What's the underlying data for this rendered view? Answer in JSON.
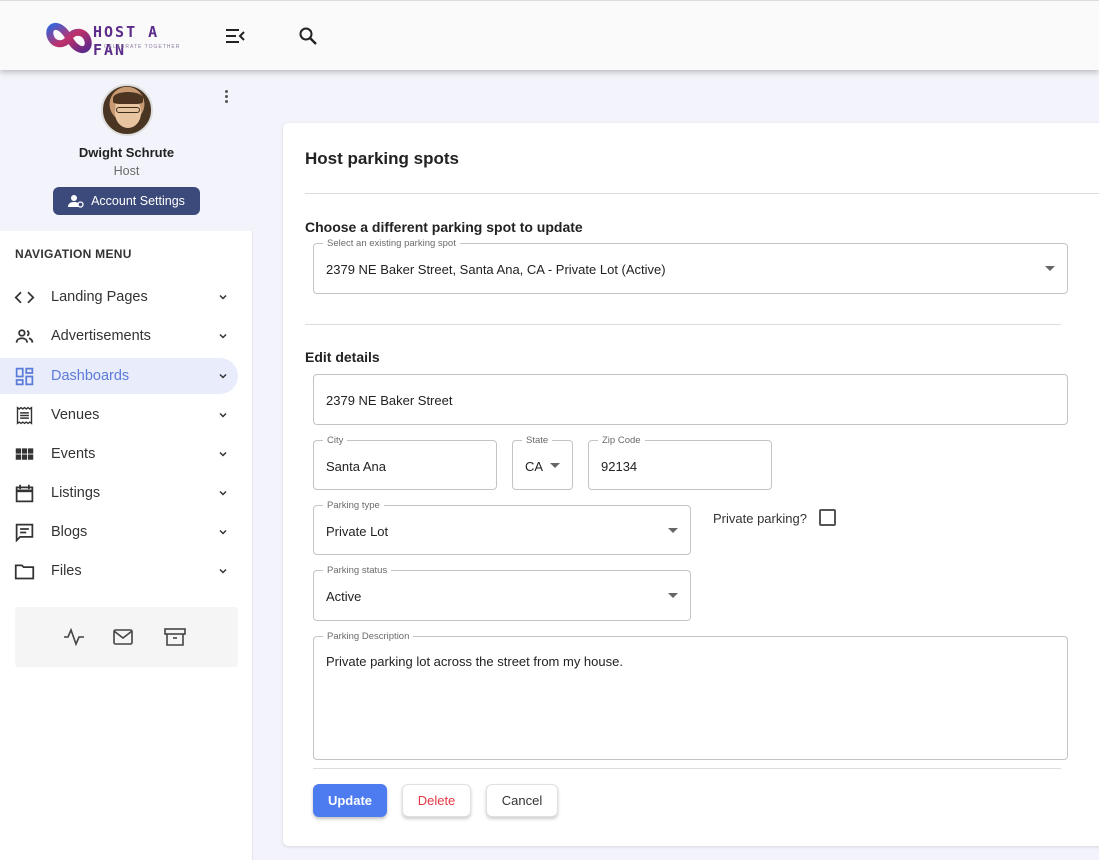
{
  "brand": {
    "name": "HOST A FAN",
    "tagline": "CELEBRATE TOGETHER"
  },
  "topbar": {
    "menu_icon": "menu-collapse-icon",
    "search_icon": "search-icon"
  },
  "profile": {
    "name": "Dwight  Schrute",
    "role": "Host",
    "account_button": "Account Settings",
    "account_icon": "user-cog-icon"
  },
  "nav": {
    "heading": "NAVIGATION MENU",
    "items": [
      {
        "label": "Landing Pages",
        "icon": "code-icon"
      },
      {
        "label": "Advertisements",
        "icon": "people-icon"
      },
      {
        "label": "Dashboards",
        "icon": "dashboard-icon",
        "active": true
      },
      {
        "label": "Venues",
        "icon": "receipt-icon"
      },
      {
        "label": "Events",
        "icon": "grid-icon"
      },
      {
        "label": "Listings",
        "icon": "calendar-icon"
      },
      {
        "label": "Blogs",
        "icon": "comment-icon"
      },
      {
        "label": "Files",
        "icon": "folder-icon"
      }
    ]
  },
  "quick_icons": [
    "activity-icon",
    "mail-icon",
    "archive-icon"
  ],
  "page": {
    "title": "Host parking spots",
    "choose_section": "Choose a different parking spot to update",
    "spot_select": {
      "label": "Select an existing parking spot",
      "value": "2379 NE Baker Street, Santa Ana, CA - Private Lot (Active)"
    },
    "edit_section": "Edit details",
    "address": {
      "value": "2379 NE Baker Street"
    },
    "city": {
      "label": "City",
      "value": "Santa Ana"
    },
    "state": {
      "label": "State",
      "value": "CA"
    },
    "zip": {
      "label": "Zip Code",
      "value": "92134"
    },
    "parking_type": {
      "label": "Parking type",
      "value": "Private Lot"
    },
    "private_parking": {
      "label": "Private parking?",
      "checked": false
    },
    "parking_status": {
      "label": "Parking status",
      "value": "Active"
    },
    "description": {
      "label": "Parking Description",
      "value": "Private parking lot across the street from my house."
    },
    "buttons": {
      "update": "Update",
      "delete": "Delete",
      "cancel": "Cancel"
    }
  },
  "colors": {
    "accent": "#4d7cf0",
    "sidebar_active": "#5b7bd8",
    "account_button": "#3b4a7a",
    "danger": "#e53946",
    "background": "#f3f4fb"
  }
}
